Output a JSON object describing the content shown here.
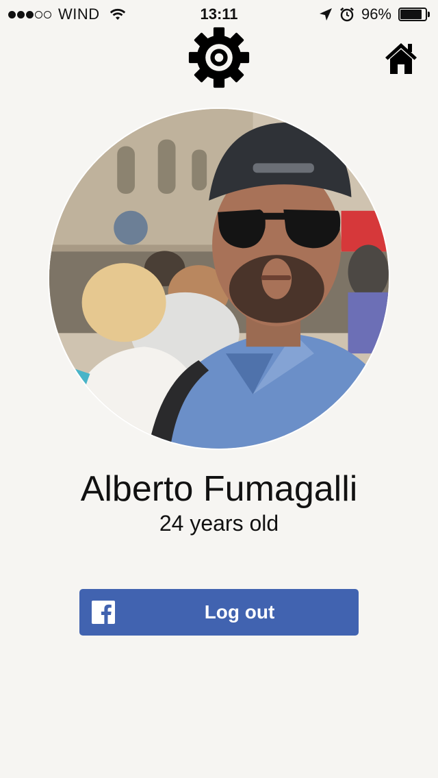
{
  "status_bar": {
    "carrier": "WIND",
    "signal_strength": 3,
    "signal_max": 5,
    "time": "13:11",
    "battery_percent_label": "96%",
    "battery_level": 0.96,
    "icons": [
      "signal-dots-icon",
      "wifi-icon",
      "location-arrow-icon",
      "alarm-clock-icon",
      "battery-icon"
    ]
  },
  "toolbar": {
    "settings_icon": "gear-icon",
    "home_icon": "home-icon"
  },
  "profile": {
    "name": "Alberto Fumagalli",
    "age": "24 years old",
    "avatar_icon": "profile-photo"
  },
  "logout": {
    "label": "Log out",
    "icon": "facebook-icon"
  },
  "colors": {
    "background": "#f6f5f2",
    "facebook_blue": "#4163b0",
    "text": "#111111"
  }
}
